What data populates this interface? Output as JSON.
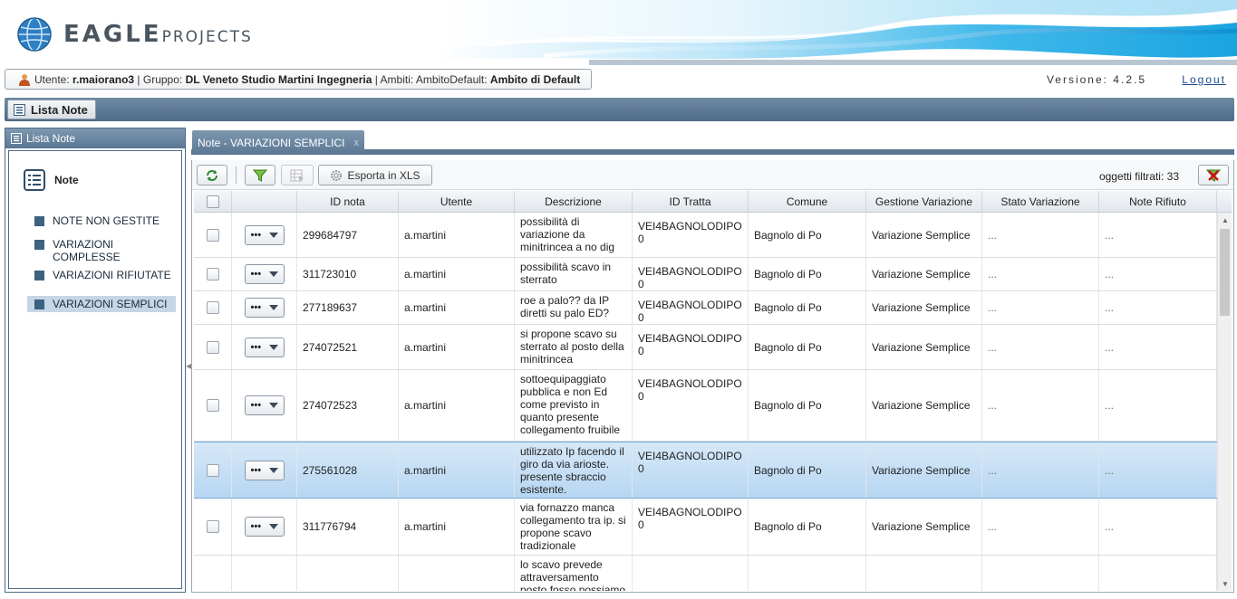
{
  "header": {
    "logo_text_big": "EAGLE",
    "logo_text_small": "PROJECTS"
  },
  "userbar": {
    "utente_label": "Utente:",
    "utente_value": "r.maiorano3",
    "gruppo_label": "| Gruppo:",
    "gruppo_value": "DL Veneto Studio Martini Ingegneria",
    "ambiti_label": "| Ambiti: AmbitoDefault:",
    "ambiti_value": "Ambito di Default",
    "version": "Versione: 4.2.5",
    "logout": "Logout"
  },
  "titlebar": {
    "button_label": "Lista Note"
  },
  "leftpanel": {
    "header": "Lista Note",
    "root": "Note",
    "items": [
      {
        "label": "NOTE NON GESTITE",
        "selected": false
      },
      {
        "label": "VARIAZIONI COMPLESSE",
        "selected": false
      },
      {
        "label": "VARIAZIONI RIFIUTATE",
        "selected": false
      },
      {
        "label": "VARIAZIONI SEMPLICI",
        "selected": true
      }
    ]
  },
  "tab": {
    "label": "Note - VARIAZIONI SEMPLICI",
    "close": "x"
  },
  "toolbar": {
    "export_label": "Esporta in XLS",
    "filtered_label": "oggetti filtrati: 33"
  },
  "grid": {
    "columns": [
      "ID nota",
      "Utente",
      "Descrizione",
      "ID Tratta",
      "Comune",
      "Gestione Variazione",
      "Stato Variazione",
      "Note Rifiuto"
    ],
    "rows": [
      {
        "id": "299684797",
        "utente": "a.martini",
        "descrizione": "possibilità di variazione da minitrincea a no dig",
        "tratta": "VEI4BAGNOLODIPO0",
        "comune": "Bagnolo di Po",
        "gestione": "Variazione Semplice",
        "stato": "...",
        "rifiuto": "...",
        "selected": false
      },
      {
        "id": "311723010",
        "utente": "a.martini",
        "descrizione": "possibilità scavo in sterrato",
        "tratta": "VEI4BAGNOLODIPO0",
        "comune": "Bagnolo di Po",
        "gestione": "Variazione Semplice",
        "stato": "...",
        "rifiuto": "...",
        "selected": false
      },
      {
        "id": "277189637",
        "utente": "a.martini",
        "descrizione": "roe a palo?? da IP diretti su palo ED?",
        "tratta": "VEI4BAGNOLODIPO0",
        "comune": "Bagnolo di Po",
        "gestione": "Variazione Semplice",
        "stato": "...",
        "rifiuto": "...",
        "selected": false
      },
      {
        "id": "274072521",
        "utente": "a.martini",
        "descrizione": "si propone scavo su sterrato al posto della minitrincea",
        "tratta": "VEI4BAGNOLODIPO0",
        "comune": "Bagnolo di Po",
        "gestione": "Variazione Semplice",
        "stato": "...",
        "rifiuto": "...",
        "selected": false
      },
      {
        "id": "274072523",
        "utente": "a.martini",
        "descrizione": "sottoequipaggiato pubblica e non Ed come previsto in quanto presente collegamento fruibile",
        "tratta": "VEI4BAGNOLODIPO0",
        "comune": "Bagnolo di Po",
        "gestione": "Variazione Semplice",
        "stato": "...",
        "rifiuto": "...",
        "selected": false
      },
      {
        "id": "275561028",
        "utente": "a.martini",
        "descrizione": "utilizzato Ip facendo il giro da via arioste. presente sbraccio esistente.",
        "tratta": "VEI4BAGNOLODIPO0",
        "comune": "Bagnolo di Po",
        "gestione": "Variazione Semplice",
        "stato": "...",
        "rifiuto": "...",
        "selected": true
      },
      {
        "id": "311776794",
        "utente": "a.martini",
        "descrizione": "via fornazzo manca collegamento tra ip. si propone scavo tradizionale",
        "tratta": "VEI4BAGNOLODIPO0",
        "comune": "Bagnolo di Po",
        "gestione": "Variazione Semplice",
        "stato": "...",
        "rifiuto": "...",
        "selected": false
      },
      {
        "id": "",
        "utente": "",
        "descrizione": "lo scavo prevede attraversamento posto fosso possiamo",
        "tratta": "",
        "comune": "",
        "gestione": "",
        "stato": "",
        "rifiuto": "",
        "selected": false
      }
    ]
  },
  "colors": {
    "accent": "#5a7692",
    "selected_row": "#b7d6f2",
    "tree_square": "#3c6281"
  },
  "icons": [
    "globe-logo-icon",
    "user-icon",
    "list-icon",
    "refresh-icon",
    "filter-icon",
    "grid-export-icon",
    "gear-icon",
    "clear-filter-icon",
    "close-icon"
  ]
}
